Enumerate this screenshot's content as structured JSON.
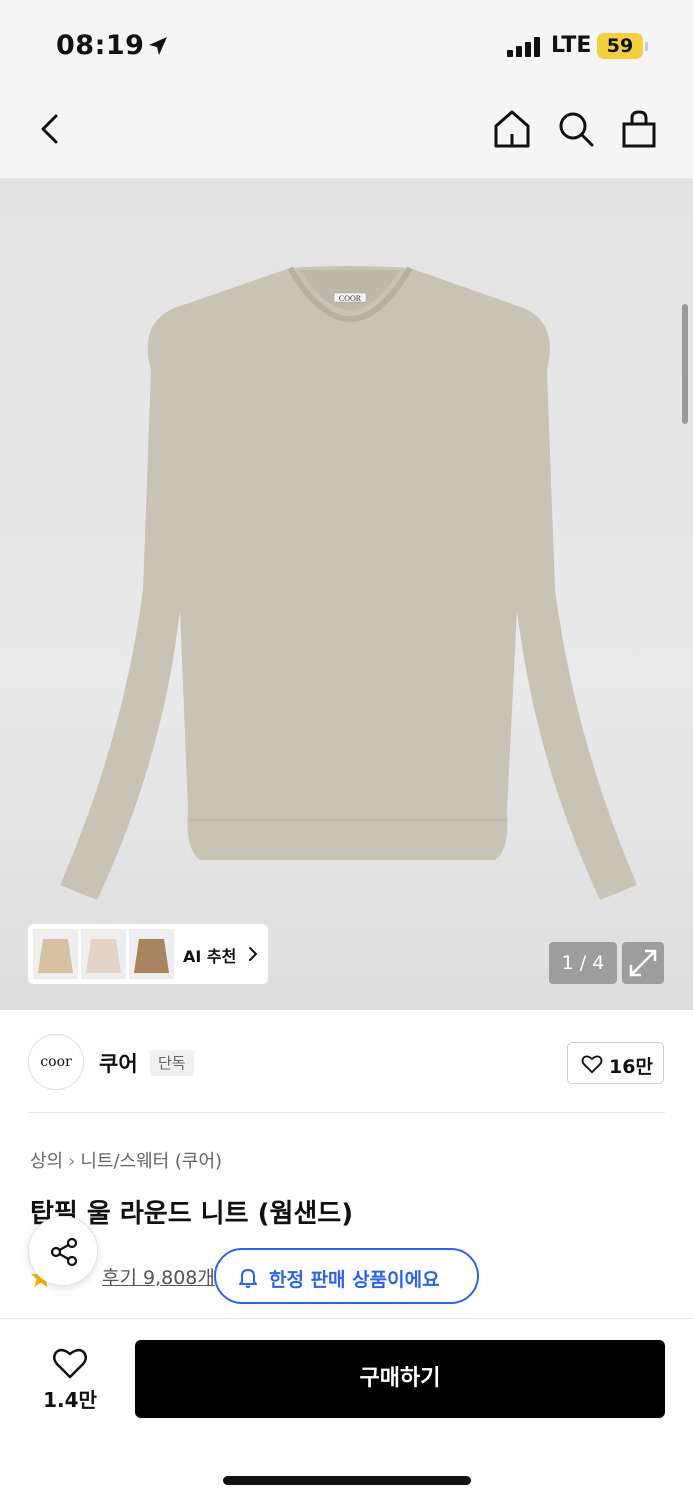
{
  "status_bar": {
    "time": "08:19",
    "network": "LTE",
    "battery": "59"
  },
  "nav": {
    "back_icon": "chevron-left-icon",
    "home_icon": "home-icon",
    "search_icon": "search-icon",
    "bag_icon": "shopping-bag-icon"
  },
  "gallery": {
    "counter": "1 / 4",
    "ai_recommend": "AI 추천",
    "sweater_label": "COOR"
  },
  "brand": {
    "logo_text": "coor",
    "name": "쿠어",
    "badge": "단독",
    "likes": "16만"
  },
  "breadcrumb": {
    "category": "상의",
    "subcategory": "니트/스웨터 (쿠어)"
  },
  "product": {
    "title": "탑필 울 라운드 니트 (웜샌드)",
    "review_text": "후기 9,808개",
    "limited_notice": "한정 판매 상품이에요"
  },
  "bottom_bar": {
    "wish_count": "1.4만",
    "buy_label": "구매하기"
  },
  "colors": {
    "accent_blue": "#2c63e8",
    "buy_button": "#000000",
    "battery": "#f4d03f",
    "sweater": "#c7c4b5"
  }
}
